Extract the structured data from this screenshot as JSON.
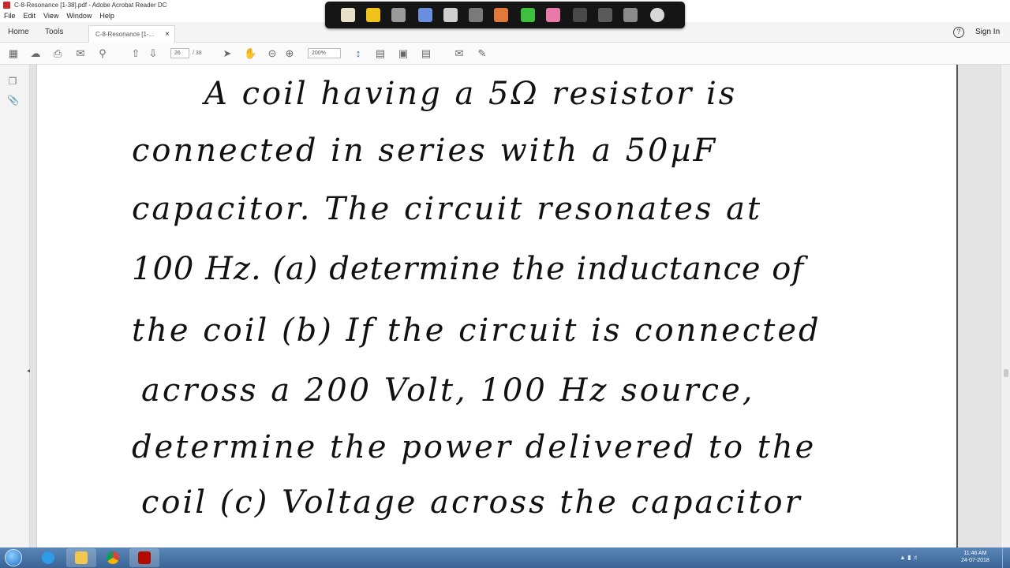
{
  "window": {
    "title": "C-8-Resonance [1-38].pdf - Adobe Acrobat Reader DC"
  },
  "menu": [
    "File",
    "Edit",
    "View",
    "Window",
    "Help"
  ],
  "tabs": {
    "home": "Home",
    "tools": "Tools",
    "document": "C-8-Resonance [1-...",
    "close": "×"
  },
  "header": {
    "help": "?",
    "signin": "Sign In"
  },
  "toolbar": {
    "page_current": "26",
    "page_total": "/ 38",
    "zoom": "200%"
  },
  "document": {
    "lines": [
      "A coil having a 5Ω resistor is",
      "connected in series with a 50µF",
      "capacitor. The circuit resonates at",
      "100 Hz. (a) determine the inductance of",
      "the coil (b) If the circuit is connected",
      "across a 200 Volt, 100 Hz source,",
      "determine the power delivered to the",
      "coil (c) Voltage across the capacitor"
    ]
  },
  "taskbar": {
    "time": "11:46 AM",
    "date": "24-07-2018"
  },
  "colors": {
    "accent": "#1f6fc2",
    "annot_bar": "#151515",
    "acrobat_red": "#c62a2a"
  }
}
